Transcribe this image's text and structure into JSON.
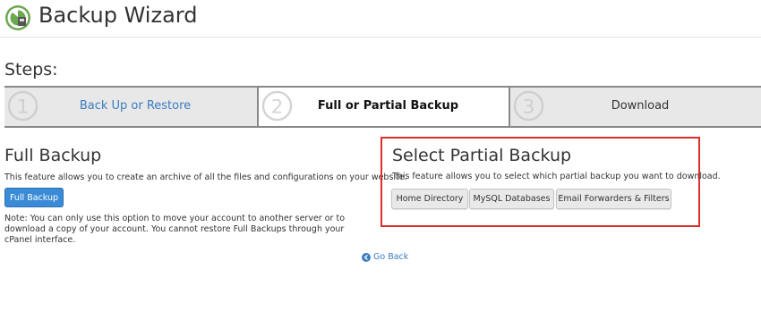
{
  "header": {
    "title": "Backup Wizard",
    "logo_icon": "backup-wizard-logo-icon",
    "logo_color": "#6aa84f"
  },
  "steps": {
    "title": "Steps:",
    "items": [
      {
        "number": "1",
        "label": "Back Up or Restore",
        "state": "completed-link"
      },
      {
        "number": "2",
        "label": "Full or Partial Backup",
        "state": "active"
      },
      {
        "number": "3",
        "label": "Download",
        "state": "upcoming"
      }
    ]
  },
  "full_backup": {
    "heading": "Full Backup",
    "description": "This feature allows you to create an archive of all the files and configurations on your website.",
    "button_label": "Full Backup",
    "note": "Note: You can only use this option to move your account to another server or to download a copy of your account. You cannot restore Full Backups through your cPanel interface."
  },
  "partial_backup": {
    "heading": "Select Partial Backup",
    "description": "This feature allows you to select which partial backup you want to download.",
    "buttons": {
      "home": "Home Directory",
      "mysql": "MySQL Databases",
      "email": "Email Forwarders & Filters"
    },
    "highlight_color": "#d9302c"
  },
  "nav": {
    "go_back_label": "Go Back",
    "go_back_icon": "circle-arrow-left-icon"
  },
  "colors": {
    "link": "#3a7cc0",
    "primary_button": "#3a8bd6"
  }
}
